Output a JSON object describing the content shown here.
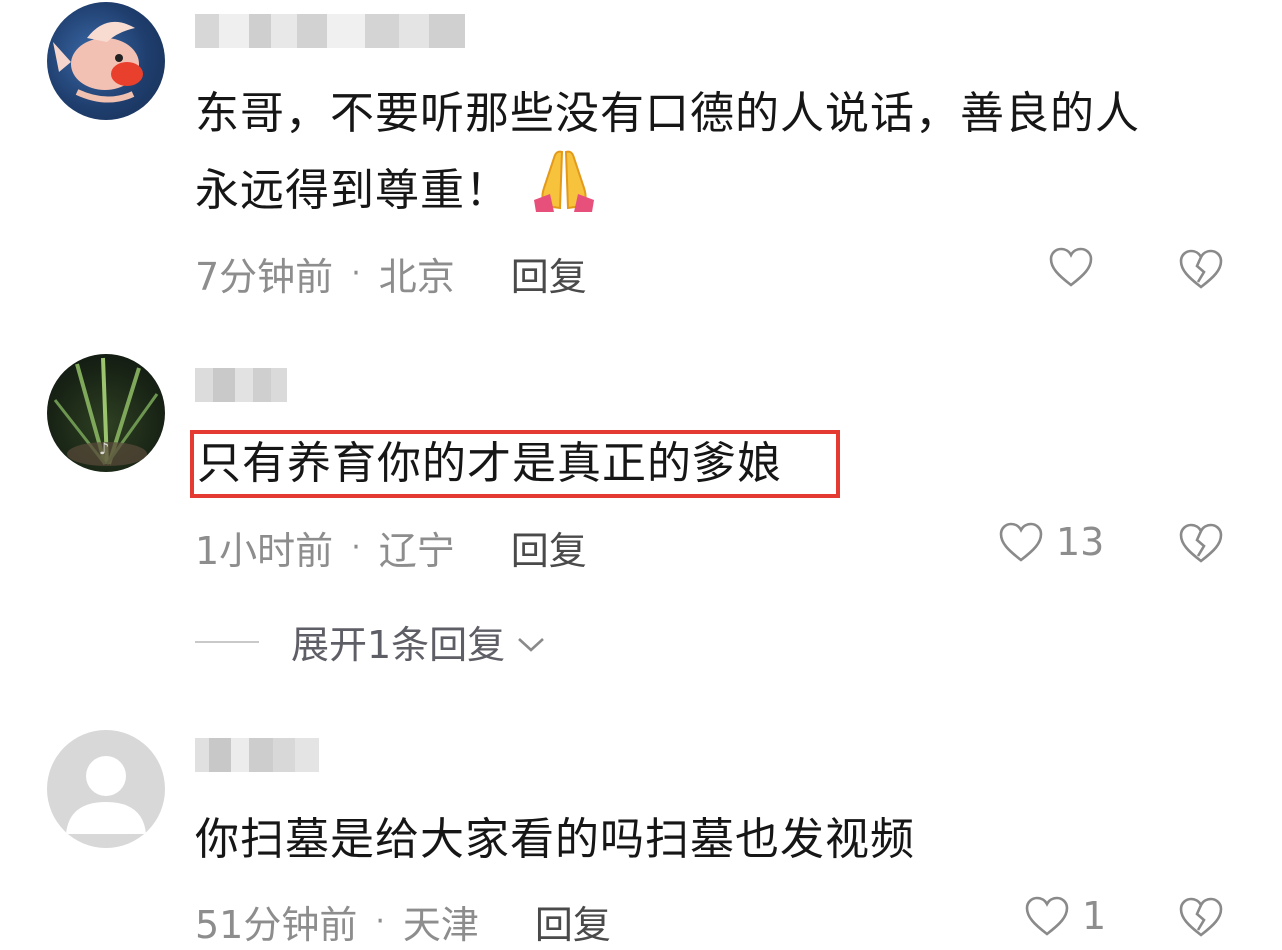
{
  "colors": {
    "highlight": "#e53a32",
    "meta_text": "#8d8d8d",
    "reply_text": "#4a4a4a"
  },
  "comments": [
    {
      "text_line1": "东哥，不要听那些没有口德的人说话，善良的人",
      "text_line2": "永远得到尊重！",
      "emoji": "folded-hands",
      "time": "7分钟前",
      "location": "北京",
      "reply_label": "回复",
      "like_count": "",
      "avatar": "fish-avatar"
    },
    {
      "text_line1": "只有养育你的才是真正的爹娘",
      "time": "1小时前",
      "location": "辽宁",
      "reply_label": "回复",
      "like_count": "13",
      "avatar": "plant-avatar",
      "expand_label": "展开1条回复"
    },
    {
      "text_line1": "你扫墓是给大家看的吗扫墓也发视频",
      "time": "51分钟前",
      "location": "天津",
      "reply_label": "回复",
      "like_count": "1",
      "avatar": "default-user-avatar"
    }
  ],
  "separator": "·"
}
